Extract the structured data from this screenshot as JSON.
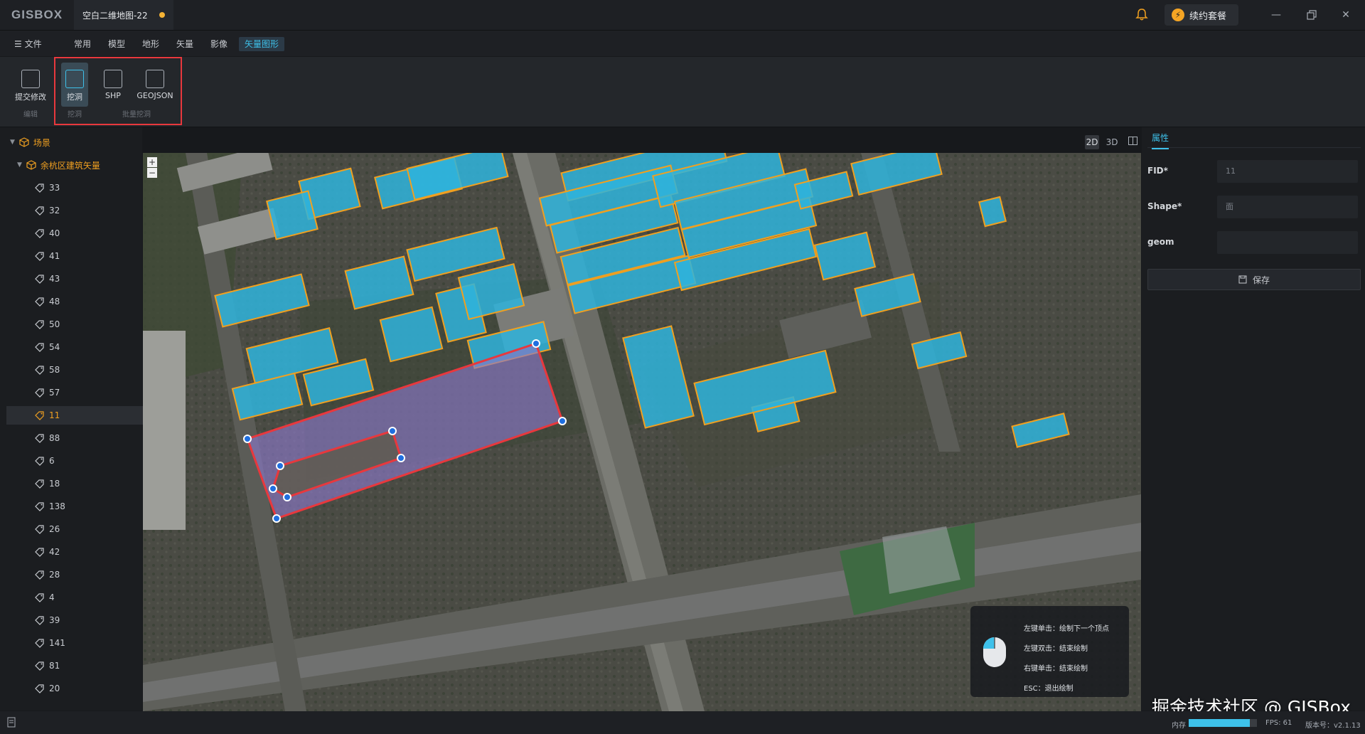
{
  "app": {
    "logo": "GISBOX",
    "doc_tab": "空白二维地图-22",
    "renew_label": "续约套餐"
  },
  "menu": {
    "file": "文件",
    "tabs": [
      "常用",
      "模型",
      "地形",
      "矢量",
      "影像",
      "矢量图形"
    ],
    "active_tab": "矢量图形"
  },
  "ribbon": {
    "buttons": [
      {
        "label": "提交修改",
        "group": "编辑"
      },
      {
        "label": "挖洞",
        "group": "挖洞"
      },
      {
        "label": "SHP"
      },
      {
        "label": "GEOJSON"
      }
    ],
    "groups": {
      "edit": "编辑",
      "dig": "挖洞",
      "batch": "批量挖洞"
    }
  },
  "tree": {
    "scene": "场景",
    "layer": "余杭区建筑矢量",
    "items": [
      "33",
      "32",
      "40",
      "41",
      "43",
      "48",
      "50",
      "54",
      "58",
      "57",
      "11",
      "88",
      "6",
      "18",
      "138",
      "26",
      "42",
      "28",
      "4",
      "39",
      "141",
      "81",
      "20"
    ],
    "selected": "11"
  },
  "view_modes": [
    "2D",
    "3D",
    "split"
  ],
  "properties": {
    "tab": "属性",
    "fields": [
      {
        "label": "FID*",
        "value": "11"
      },
      {
        "label": "Shape*",
        "value": "面"
      },
      {
        "label": "geom",
        "value": ""
      }
    ],
    "save_label": "保存"
  },
  "draw_hints": [
    "左键单击：绘制下一个顶点",
    "左键双击：结束绘制",
    "右键单击：结束绘制",
    "ESC：退出绘制"
  ],
  "zoom": {
    "in": "+",
    "out": "−"
  },
  "status": {
    "memory_label": "内存",
    "memory_fraction": 0.9,
    "fps": "FPS: 61",
    "version": "版本号：v2.1.13"
  },
  "watermark": "掘金技术社区 @ GISBox",
  "colors": {
    "accent": "#3ec1ea",
    "highlight": "#e8383d",
    "building_fill": "#2fb4dc",
    "building_outline": "#f0a020",
    "dig_polygon": "#8a78c8"
  }
}
